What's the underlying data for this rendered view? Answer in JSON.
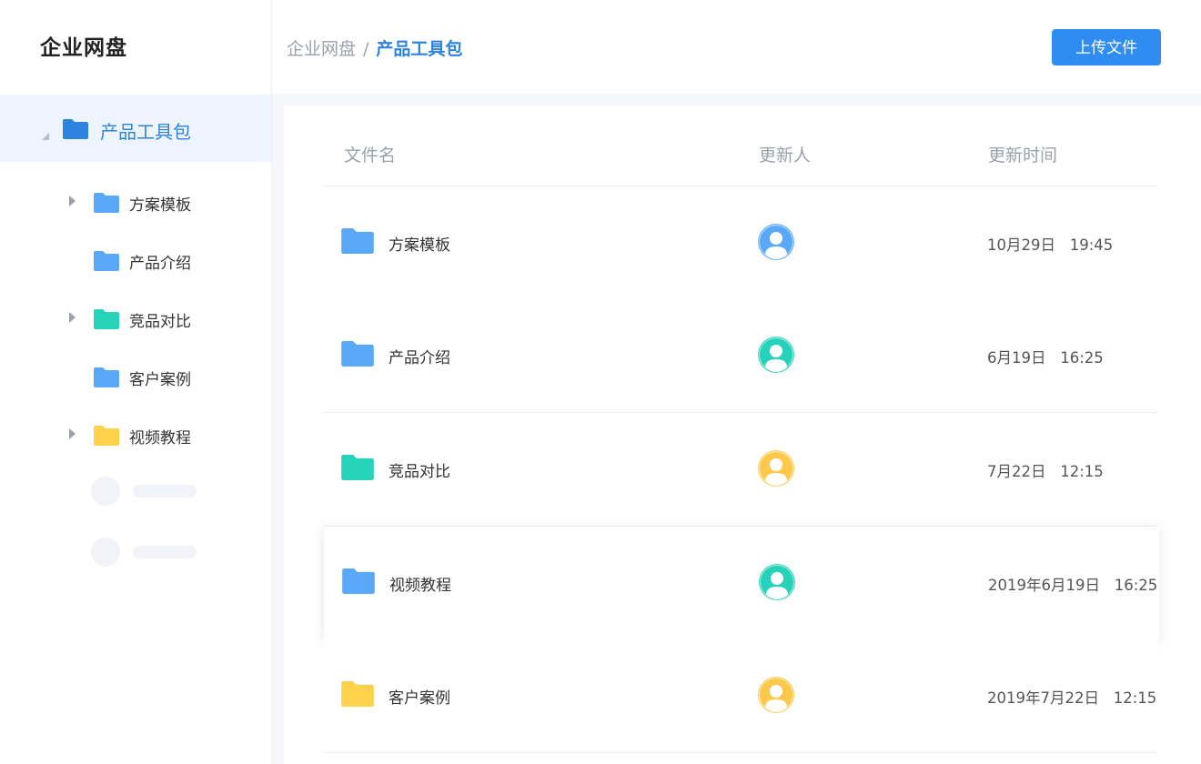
{
  "app": {
    "title": "企业网盘"
  },
  "breadcrumb": {
    "root": "企业网盘",
    "separator": "/",
    "current": "产品工具包"
  },
  "toolbar": {
    "upload_label": "上传文件"
  },
  "colors": {
    "accent": "#2f8cf0",
    "folder_blue": "#5aa9f8",
    "folder_teal": "#26d2b9",
    "folder_yellow": "#fdd14a",
    "root_folder": "#2d84e0"
  },
  "sidebar": {
    "root": {
      "label": "产品工具包",
      "icon": "folder-icon",
      "expanded": true
    },
    "items": [
      {
        "label": "方案模板",
        "color": "blue",
        "has_children": true
      },
      {
        "label": "产品介绍",
        "color": "blue",
        "has_children": false
      },
      {
        "label": "竞品对比",
        "color": "teal",
        "has_children": true
      },
      {
        "label": "客户案例",
        "color": "blue",
        "has_children": false
      },
      {
        "label": "视频教程",
        "color": "yellow",
        "has_children": true
      }
    ]
  },
  "table": {
    "columns": [
      "文件名",
      "更新人",
      "更新时间"
    ],
    "rows": [
      {
        "name": "方案模板",
        "folder_color": "blue",
        "avatar_color": "#5aa9f8",
        "time": "10月29日   19:45"
      },
      {
        "name": "产品介绍",
        "folder_color": "blue",
        "avatar_color": "#26d2b9",
        "time": "6月19日   16:25"
      },
      {
        "name": "竞品对比",
        "folder_color": "teal",
        "avatar_color": "#fdc94a",
        "time": "7月22日   12:15"
      },
      {
        "name": "视频教程",
        "folder_color": "blue",
        "avatar_color": "#26d2b9",
        "time": "2019年6月19日   16:25",
        "highlighted": true
      },
      {
        "name": "客户案例",
        "folder_color": "yellow",
        "avatar_color": "#fdc94a",
        "time": "2019年7月22日   12:15"
      }
    ]
  }
}
